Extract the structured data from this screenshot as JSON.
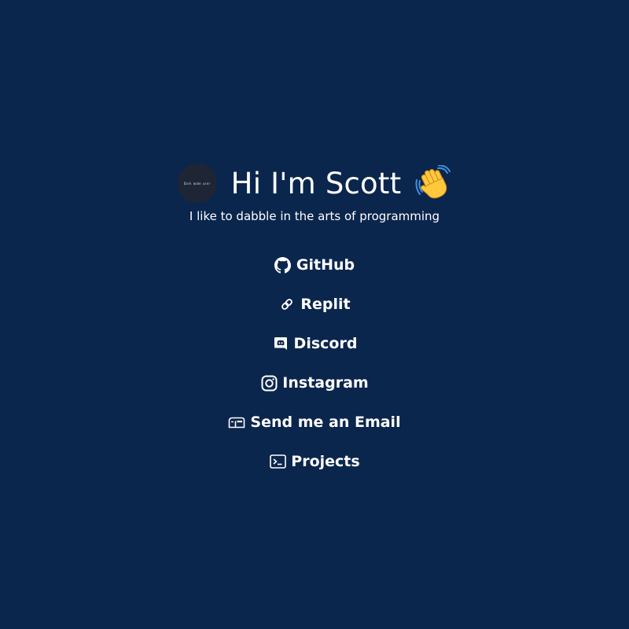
{
  "profile": {
    "avatar_text": "Dark mode user",
    "title": "Hi I'm Scott",
    "emoji": "waving-hand",
    "subtitle": "I like to dabble in the arts of programming"
  },
  "links": [
    {
      "label": "GitHub",
      "icon": "github-icon"
    },
    {
      "label": "Replit",
      "icon": "link-icon"
    },
    {
      "label": "Discord",
      "icon": "discord-icon"
    },
    {
      "label": "Instagram",
      "icon": "instagram-icon"
    },
    {
      "label": "Send me an Email",
      "icon": "mailbox-icon"
    },
    {
      "label": "Projects",
      "icon": "terminal-icon"
    }
  ],
  "colors": {
    "background": "#0b264d",
    "text": "#ffffff",
    "avatar_bg": "#1e2535",
    "wave": "#ffc83d"
  }
}
